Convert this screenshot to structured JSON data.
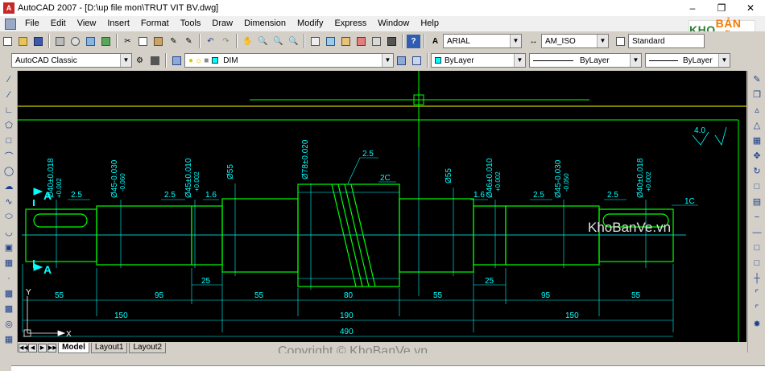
{
  "window": {
    "title": "AutoCAD 2007 - [D:\\up file mon\\TRUT VIT BV.dwg]",
    "app_icon": "A"
  },
  "menu": [
    "File",
    "Edit",
    "View",
    "Insert",
    "Format",
    "Tools",
    "Draw",
    "Dimension",
    "Modify",
    "Express",
    "Window",
    "Help"
  ],
  "toolbar1": {
    "text_style": "ARIAL",
    "dim_style": "AM_ISO",
    "table_style": "Standard"
  },
  "toolbar2": {
    "workspace": "AutoCAD Classic",
    "layer": "DIM",
    "color": "ByLayer",
    "linetype": "ByLayer",
    "lineweight": "ByLayer"
  },
  "tabs": [
    "Model",
    "Layout1",
    "Layout2"
  ],
  "active_tab": "Model",
  "watermark": {
    "top": "KhoBanVe.vn",
    "bottom": "Copyright © KhoBanVe.vn",
    "logo_a": "KHO",
    "logo_b": "BẢN VẼ"
  },
  "drawing": {
    "dims_top": [
      "Ø40±0.018\n+0.002",
      "Ø45-0.030\n-0.060",
      "Ø45±0.010\n+0.002",
      "Ø55",
      "Ø78±0.020",
      "Ø55",
      "Ø46±0.010\n+0.002",
      "Ø45-0.030\n-0.050",
      "Ø40±0.018\n+0.002"
    ],
    "chamfers": [
      "2.5",
      "2.5",
      "1.6",
      "2.5",
      "2C",
      "1.6",
      "2.5",
      "2.5",
      "1C"
    ],
    "roughness": "4.0",
    "section_marks": [
      "A",
      "A"
    ],
    "dims_row1": [
      "55",
      "95",
      "25",
      "55",
      "80",
      "55",
      "25",
      "95",
      "55"
    ],
    "dims_row2": [
      "150",
      "190",
      "150"
    ],
    "dims_total": "490",
    "ucs_x": "X",
    "ucs_y": "Y"
  },
  "colors": {
    "canvas": "#000000",
    "geometry": "#00ff00",
    "dimension": "#00ffff",
    "border": "#ffff00"
  }
}
